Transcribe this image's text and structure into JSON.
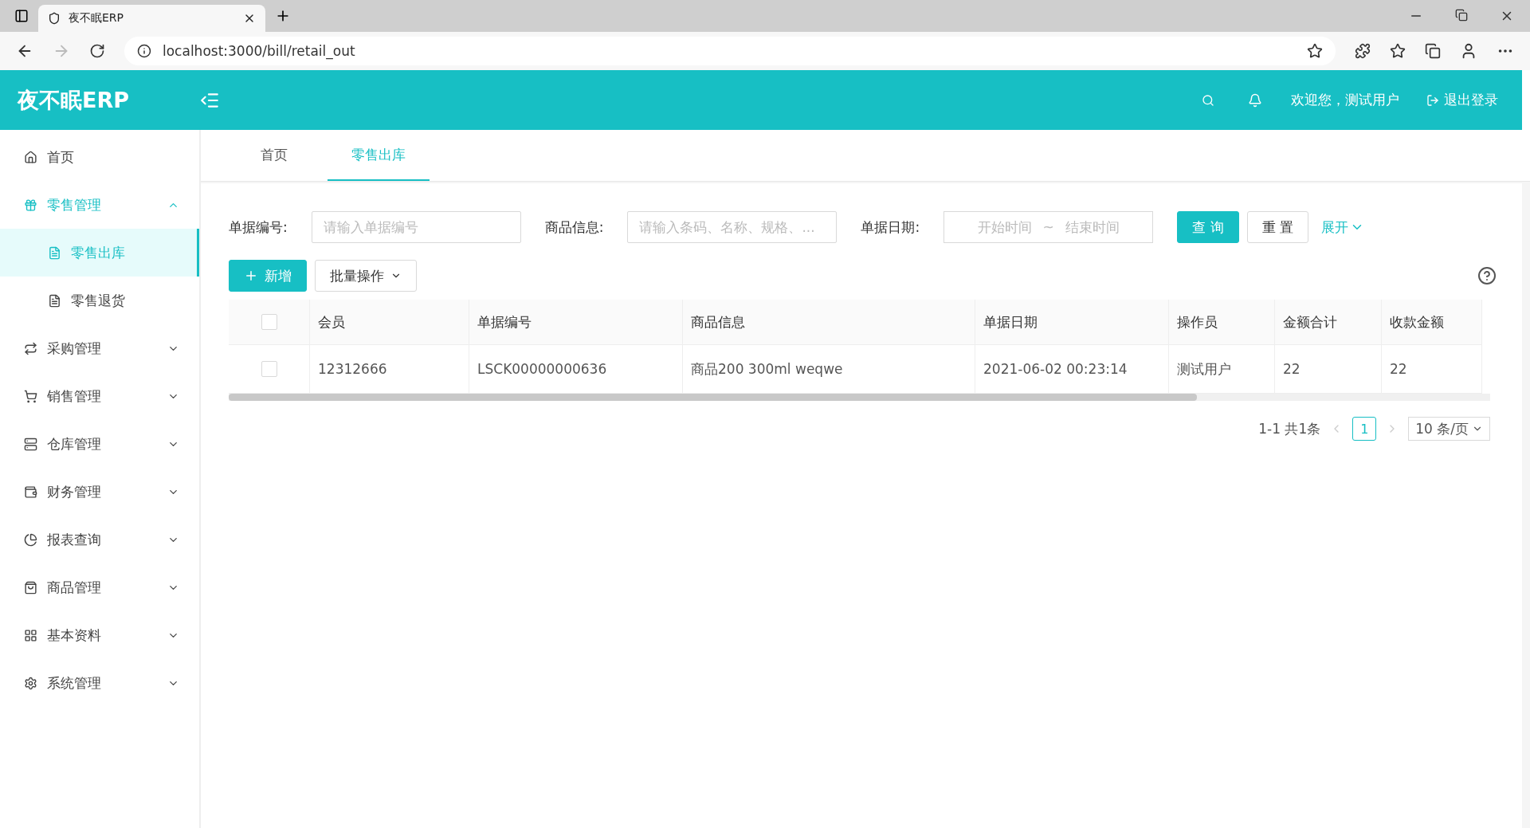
{
  "browser": {
    "tab_title": "夜不眠ERP",
    "url": "localhost:3000/bill/retail_out"
  },
  "header": {
    "logo": "夜不眠ERP",
    "welcome": "欢迎您，测试用户",
    "logout": "退出登录"
  },
  "sidebar": {
    "items": [
      {
        "label": "首页",
        "selected": false
      },
      {
        "label": "零售管理",
        "selected": true,
        "expanded": true,
        "children": [
          {
            "label": "零售出库",
            "selected": true
          },
          {
            "label": "零售退货",
            "selected": false
          }
        ]
      },
      {
        "label": "采购管理",
        "selected": false,
        "expanded": false
      },
      {
        "label": "销售管理",
        "selected": false,
        "expanded": false
      },
      {
        "label": "仓库管理",
        "selected": false,
        "expanded": false
      },
      {
        "label": "财务管理",
        "selected": false,
        "expanded": false
      },
      {
        "label": "报表查询",
        "selected": false,
        "expanded": false
      },
      {
        "label": "商品管理",
        "selected": false,
        "expanded": false
      },
      {
        "label": "基本资料",
        "selected": false,
        "expanded": false
      },
      {
        "label": "系统管理",
        "selected": false,
        "expanded": false
      }
    ]
  },
  "tabs": [
    {
      "label": "首页",
      "selected": false
    },
    {
      "label": "零售出库",
      "selected": true
    }
  ],
  "filters": [
    {
      "label": "单据编号:",
      "placeholder": "请输入单据编号"
    },
    {
      "label": "商品信息:",
      "placeholder": "请输入条码、名称、规格、..."
    }
  ],
  "date_filter": {
    "label": "单据日期:",
    "start_placeholder": "开始时间",
    "separator": "~",
    "end_placeholder": "结束时间"
  },
  "query_button": "查 询",
  "reset_button": "重 置",
  "expand_link": "展开",
  "toolbar": {
    "add": "新增",
    "batch": "批量操作"
  },
  "table": {
    "header_checked": false,
    "columns": [
      "会员",
      "单据编号",
      "商品信息",
      "单据日期",
      "操作员",
      "金额合计",
      "收款金额"
    ],
    "rows": [
      {
        "checked": false,
        "cells": [
          "12312666",
          "LSCK00000000636",
          "商品200 300ml weqwe",
          "2021-06-02 00:23:14",
          "测试用户",
          "22",
          "22"
        ]
      }
    ]
  },
  "pagination": {
    "summary": "1-1 共1条",
    "pages": [
      {
        "label": "1",
        "selected": true
      }
    ],
    "page_size": "10 条/页"
  }
}
